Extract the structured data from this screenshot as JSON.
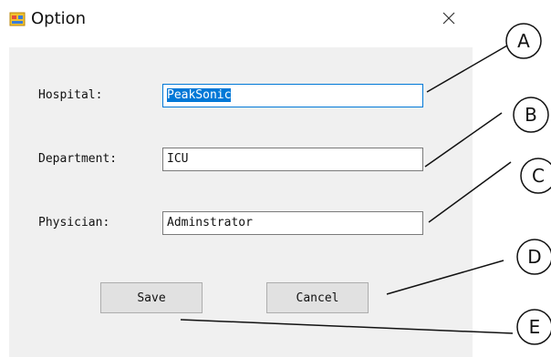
{
  "window": {
    "title": "Option",
    "app_icon": "windows-form-icon",
    "close_icon": "close-icon"
  },
  "form": {
    "hospital_label": "Hospital:",
    "hospital_value_selected": "PeakSonic",
    "department_label": "Department:",
    "department_value": "ICU",
    "physician_label": "Physician:",
    "physician_value": "Adminstrator"
  },
  "buttons": {
    "save_label": "Save",
    "cancel_label": "Cancel"
  },
  "annotations": {
    "a": "A",
    "b": "B",
    "c": "C",
    "d": "D",
    "e": "E"
  },
  "colors": {
    "accent": "#0078d7",
    "form_background": "#f0f0f0",
    "button_face": "#e1e1e1"
  }
}
